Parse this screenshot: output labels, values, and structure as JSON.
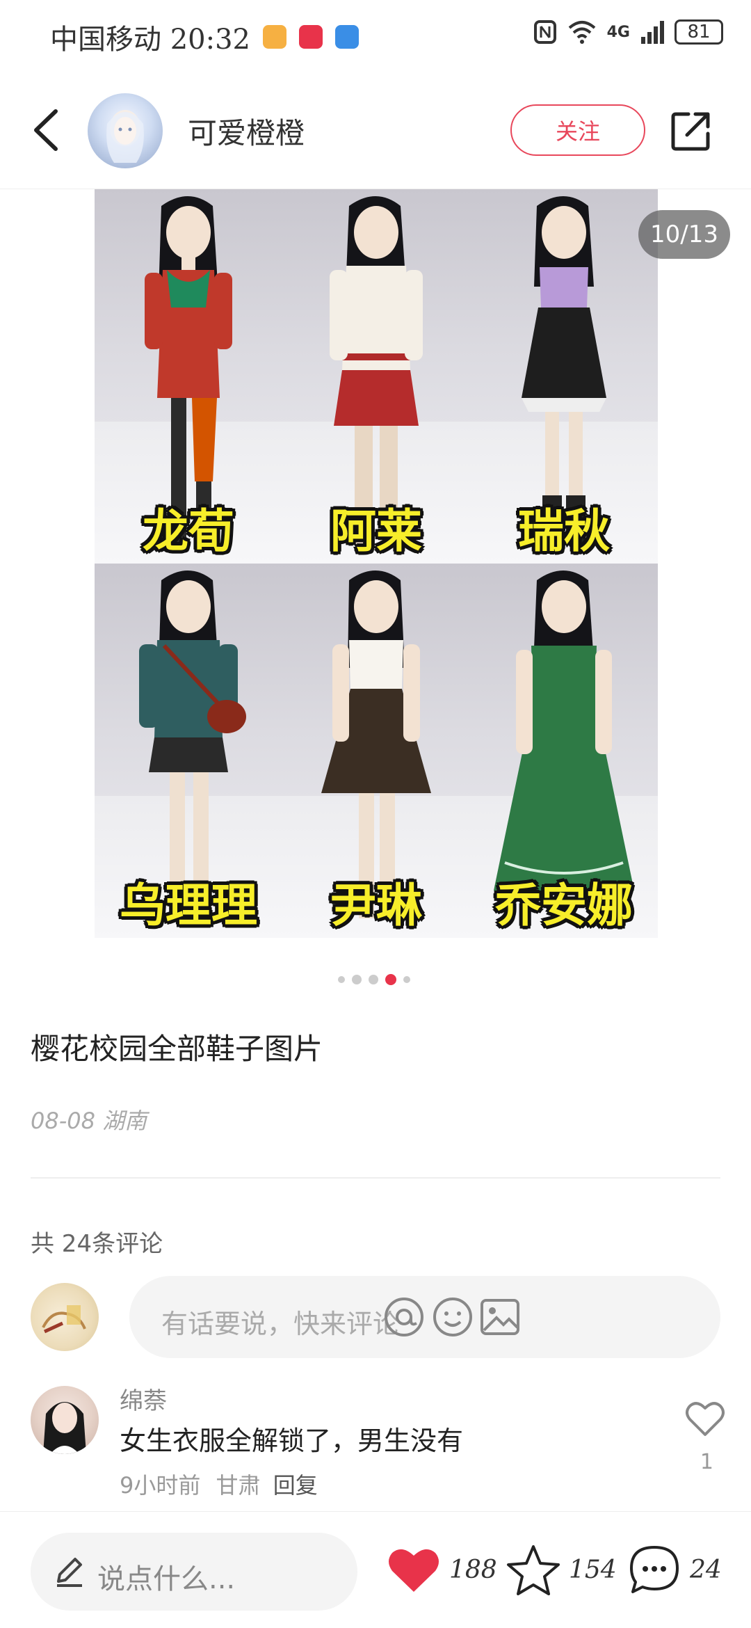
{
  "status_bar": {
    "carrier_time": "中国移动 20:32",
    "network": "4G",
    "battery": "81"
  },
  "header": {
    "author_name": "可爱橙橙",
    "follow_label": "关注"
  },
  "carousel": {
    "page_counter": "10/13",
    "characters": [
      "龙荀",
      "阿莱",
      "瑞秋",
      "乌理理",
      "尹琳",
      "乔安娜"
    ]
  },
  "post": {
    "title": "樱花校园全部鞋子图片",
    "meta": "08-08 湖南"
  },
  "comments": {
    "count_label": "共 24条评论",
    "input_placeholder": "有话要说，快来评论",
    "items": [
      {
        "name": "绵萘",
        "text": "女生衣服全解锁了，男生没有",
        "time": "9小时前",
        "location": "甘肃",
        "reply_label": "回复",
        "likes": "1"
      }
    ]
  },
  "bottom_bar": {
    "say_placeholder": "说点什么...",
    "likes": "188",
    "stars": "154",
    "comments": "24"
  },
  "colors": {
    "accent": "#e8334a",
    "label_yellow": "#f7ee2a"
  }
}
